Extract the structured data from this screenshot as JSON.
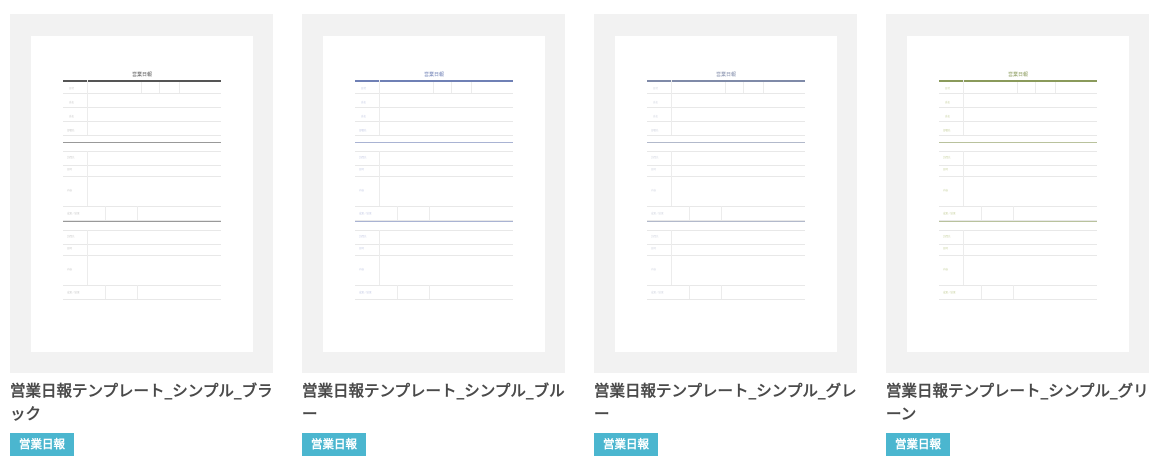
{
  "template_doc": {
    "title": "営業日報",
    "header_labels": [
      "日付",
      "",
      "氏名",
      "",
      "部署名",
      "担当"
    ],
    "visit_labels": [
      "訪問先",
      "日時",
      "内容",
      "成果／結果"
    ]
  },
  "cards": [
    {
      "title": "営業日報テンプレート_シンプル_ブラック",
      "tag": "営業日報",
      "accent": "#555555",
      "text_color": "#c9c9c9"
    },
    {
      "title": "営業日報テンプレート_シンプル_ブルー",
      "tag": "営業日報",
      "accent": "#6f80b5",
      "text_color": "#c5cbe4"
    },
    {
      "title": "営業日報テンプレート_シンプル_グレー",
      "tag": "営業日報",
      "accent": "#7f8aa8",
      "text_color": "#cfd3de"
    },
    {
      "title": "営業日報テンプレート_シンプル_グリーン",
      "tag": "営業日報",
      "accent": "#8a9a5b",
      "text_color": "#c7d09f"
    }
  ]
}
